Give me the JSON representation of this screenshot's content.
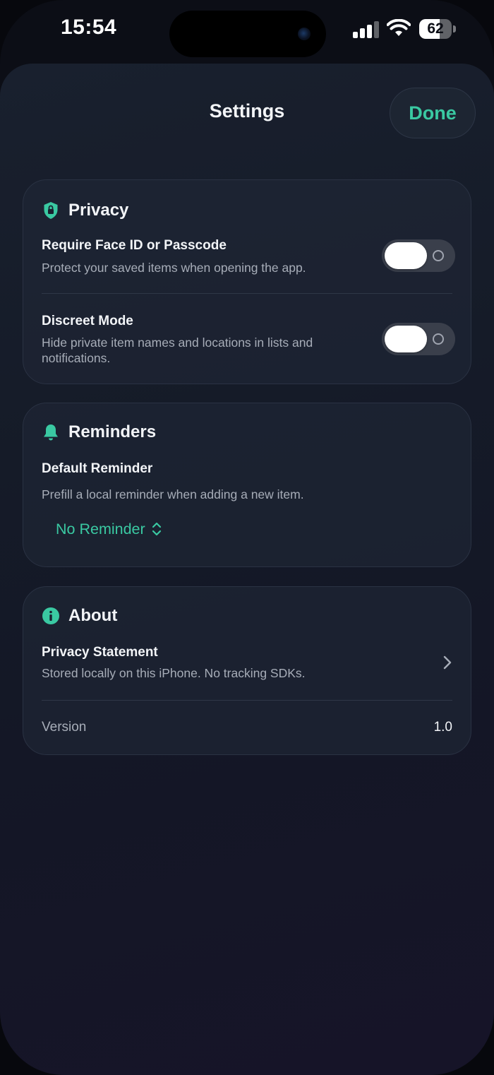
{
  "status_bar": {
    "time": "15:54",
    "battery_level": "62",
    "battery_fraction": 0.62
  },
  "nav": {
    "title": "Settings",
    "done_label": "Done"
  },
  "privacy": {
    "title": "Privacy",
    "icon": "shield-lock-icon",
    "require_auth": {
      "title": "Require Face ID or Passcode",
      "subtitle": "Protect your saved items when opening the app.",
      "enabled": false
    },
    "discreet_mode": {
      "title": "Discreet Mode",
      "subtitle_line1": "Hide private item names and locations in lists and",
      "subtitle_line2": "notifications.",
      "enabled": false
    }
  },
  "reminders": {
    "title": "Reminders",
    "icon": "bell-icon",
    "default_reminder": {
      "title": "Default Reminder",
      "subtitle": "Prefill a local reminder when adding a new item.",
      "selected": "No Reminder"
    }
  },
  "about": {
    "title": "About",
    "icon": "info-icon",
    "privacy_statement": {
      "title": "Privacy Statement",
      "subtitle": "Stored locally on this iPhone. No tracking SDKs."
    },
    "version_label": "Version",
    "version_value": "1.0"
  },
  "colors": {
    "accent": "#3ac9a2",
    "background": "#151b28",
    "card": "#1e2534",
    "toggle_off": "#3a3f4b"
  }
}
